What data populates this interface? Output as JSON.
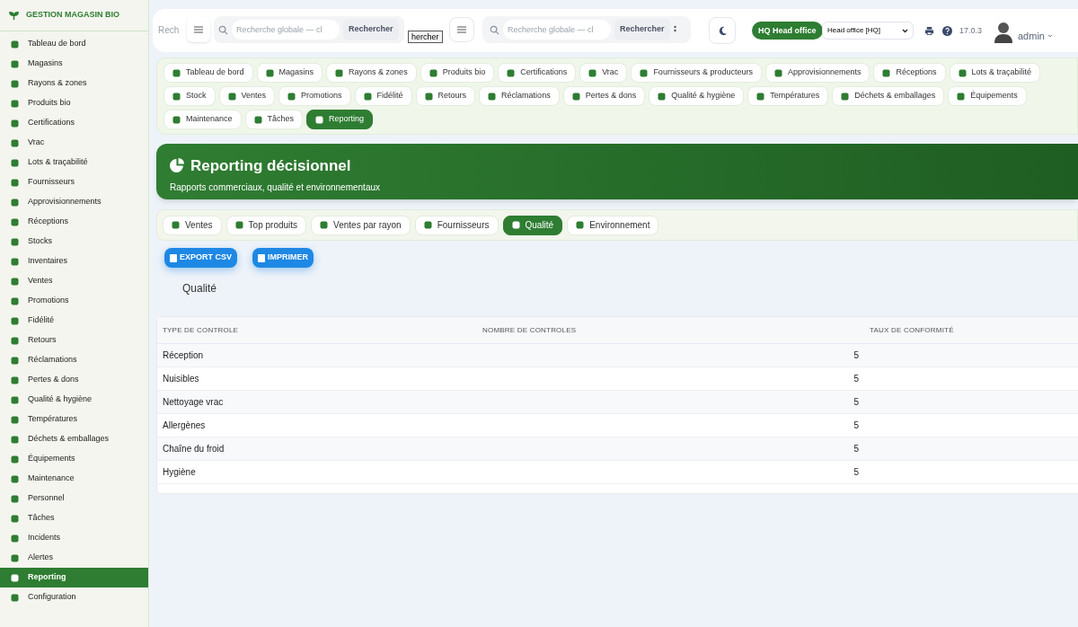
{
  "sidebar": {
    "brand": "GESTION MAGASIN BIO",
    "items": [
      {
        "label": "Tableau de bord",
        "selected": false
      },
      {
        "label": "Magasins",
        "selected": false
      },
      {
        "label": "Rayons & zones",
        "selected": false
      },
      {
        "label": "Produits bio",
        "selected": false
      },
      {
        "label": "Certifications",
        "selected": false
      },
      {
        "label": "Vrac",
        "selected": false
      },
      {
        "label": "Lots & traçabilité",
        "selected": false
      },
      {
        "label": "Fournisseurs",
        "selected": false
      },
      {
        "label": "Approvisionnements",
        "selected": false
      },
      {
        "label": "Réceptions",
        "selected": false
      },
      {
        "label": "Stocks",
        "selected": false
      },
      {
        "label": "Inventaires",
        "selected": false
      },
      {
        "label": "Ventes",
        "selected": false
      },
      {
        "label": "Promotions",
        "selected": false
      },
      {
        "label": "Fidélité",
        "selected": false
      },
      {
        "label": "Retours",
        "selected": false
      },
      {
        "label": "Réclamations",
        "selected": false
      },
      {
        "label": "Pertes & dons",
        "selected": false
      },
      {
        "label": "Qualité & hygiène",
        "selected": false
      },
      {
        "label": "Températures",
        "selected": false
      },
      {
        "label": "Déchets & emballages",
        "selected": false
      },
      {
        "label": "Équipements",
        "selected": false
      },
      {
        "label": "Maintenance",
        "selected": false
      },
      {
        "label": "Personnel",
        "selected": false
      },
      {
        "label": "Tâches",
        "selected": false
      },
      {
        "label": "Incidents",
        "selected": false
      },
      {
        "label": "Alertes",
        "selected": false
      },
      {
        "label": "Reporting",
        "selected": true
      },
      {
        "label": "Configuration",
        "selected": false
      }
    ]
  },
  "topbar": {
    "search_fragment": {
      "placeholder": "Rech"
    },
    "search_1": {
      "placeholder": "Recherche globale — cl",
      "button": "Rechercher"
    },
    "fragment_button": "hercher",
    "search_2": {
      "placeholder": "Recherche globale — cl",
      "button": "Rechercher"
    },
    "store_badge": "HQ Head office",
    "store_select": "Head office [HQ]",
    "version": "17.0.3",
    "user": "admin"
  },
  "module_nav": [
    {
      "label": "Tableau de bord",
      "selected": false
    },
    {
      "label": "Magasins",
      "selected": false
    },
    {
      "label": "Rayons & zones",
      "selected": false
    },
    {
      "label": "Produits bio",
      "selected": false
    },
    {
      "label": "Certifications",
      "selected": false
    },
    {
      "label": "Vrac",
      "selected": false
    },
    {
      "label": "Fournisseurs & producteurs",
      "selected": false
    },
    {
      "label": "Approvisionnements",
      "selected": false
    },
    {
      "label": "Réceptions",
      "selected": false
    },
    {
      "label": "Lots & traçabilité",
      "selected": false
    },
    {
      "label": "Stock",
      "selected": false
    },
    {
      "label": "Ventes",
      "selected": false
    },
    {
      "label": "Promotions",
      "selected": false
    },
    {
      "label": "Fidélité",
      "selected": false
    },
    {
      "label": "Retours",
      "selected": false
    },
    {
      "label": "Réclamations",
      "selected": false
    },
    {
      "label": "Pertes & dons",
      "selected": false
    },
    {
      "label": "Qualité & hygiène",
      "selected": false
    },
    {
      "label": "Températures",
      "selected": false
    },
    {
      "label": "Déchets & emballages",
      "selected": false
    },
    {
      "label": "Équipements",
      "selected": false
    },
    {
      "label": "Maintenance",
      "selected": false
    },
    {
      "label": "Tâches",
      "selected": false
    },
    {
      "label": "Reporting",
      "selected": true
    }
  ],
  "banner": {
    "title": "Reporting décisionnel",
    "subtitle": "Rapports commerciaux, qualité et environnementaux"
  },
  "report_tabs": [
    {
      "label": "Ventes",
      "selected": false
    },
    {
      "label": "Top produits",
      "selected": false
    },
    {
      "label": "Ventes par rayon",
      "selected": false
    },
    {
      "label": "Fournisseurs",
      "selected": false
    },
    {
      "label": "Qualité",
      "selected": true
    },
    {
      "label": "Environnement",
      "selected": false
    }
  ],
  "actions": [
    "EXPORT CSV",
    "IMPRIMER"
  ],
  "report_title": "Qualité",
  "table": {
    "columns": [
      "TYPE DE CONTROLE",
      "NOMBRE DE CONTROLES",
      "TAUX DE CONFORMITÉ"
    ],
    "rows": [
      [
        "Réception",
        "5"
      ],
      [
        "Nuisibles",
        "5"
      ],
      [
        "Nettoyage vrac",
        "5"
      ],
      [
        "Allergènes",
        "5"
      ],
      [
        "Chaîne du froid",
        "5"
      ],
      [
        "Hygiène",
        "5"
      ]
    ]
  }
}
